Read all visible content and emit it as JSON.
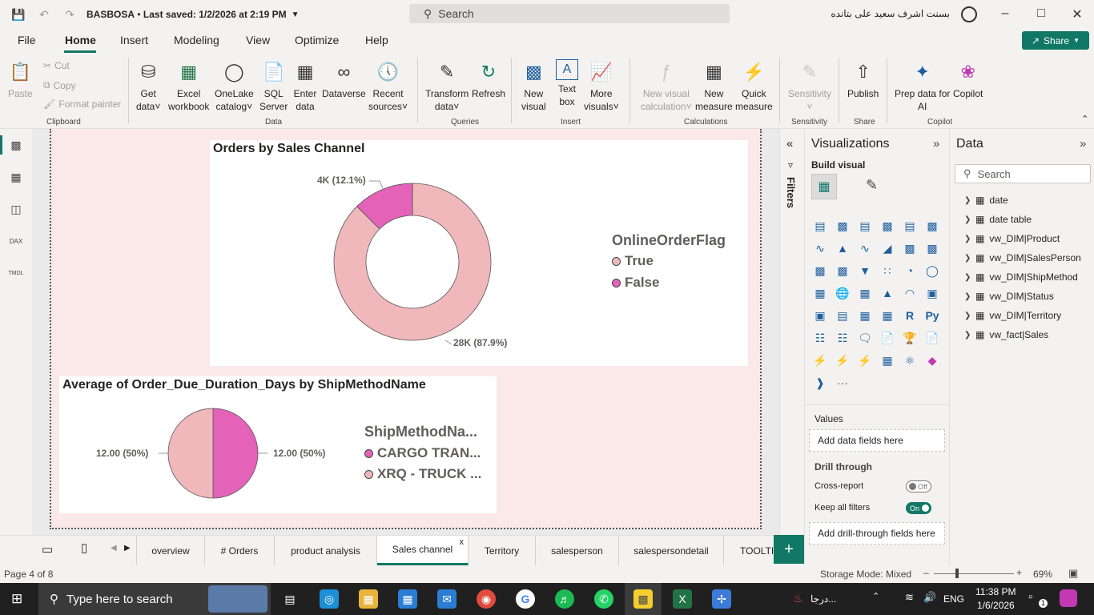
{
  "titlebar": {
    "doc_title": "BASBOSA",
    "saved_status": "Last saved: 1/2/2026 at 2:19 PM",
    "search_placeholder": "Search",
    "user_name": "بسنت اشرف سعيد على بتانده"
  },
  "menu": {
    "items": [
      "File",
      "Home",
      "Insert",
      "Modeling",
      "View",
      "Optimize",
      "Help"
    ],
    "share_label": "Share"
  },
  "ribbon": {
    "paste": "Paste",
    "cut": "Cut",
    "copy": "Copy",
    "format_painter": "Format painter",
    "clipboard_group": "Clipboard",
    "get_data": [
      "Get",
      "data"
    ],
    "excel": [
      "Excel",
      "workbook"
    ],
    "onelake": [
      "OneLake",
      "catalog"
    ],
    "sql": [
      "SQL",
      "Server"
    ],
    "enter_data": [
      "Enter",
      "data"
    ],
    "dataverse": "Dataverse",
    "recent_sources": [
      "Recent",
      "sources"
    ],
    "data_group": "Data",
    "transform": [
      "Transform",
      "data"
    ],
    "refresh": "Refresh",
    "queries_group": "Queries",
    "new_visual": [
      "New",
      "visual"
    ],
    "text_box": [
      "Text",
      "box"
    ],
    "more_visuals": [
      "More",
      "visuals"
    ],
    "insert_group": "Insert",
    "new_visual_calc": [
      "New visual",
      "calculation"
    ],
    "new_measure": [
      "New",
      "measure"
    ],
    "quick_measure": [
      "Quick",
      "measure"
    ],
    "calculations_group": "Calculations",
    "sensitivity": "Sensitivity",
    "sensitivity_group": "Sensitivity",
    "publish": "Publish",
    "share_group": "Share",
    "prep_data": [
      "Prep data for",
      "AI"
    ],
    "copilot": "Copilot",
    "copilot_group": "Copilot"
  },
  "visual1": {
    "title": "Orders by Sales Channel",
    "legend_title": "OnlineOrderFlag",
    "legend_items": [
      "True",
      "False"
    ],
    "label_true": "28K (87.9%)",
    "label_false": "4K (12.1%)"
  },
  "visual2": {
    "title": "Average of Order_Due_Duration_Days by ShipMethodName",
    "legend_title": "ShipMethodNa...",
    "legend_items": [
      "CARGO TRAN...",
      "XRQ - TRUCK ..."
    ],
    "label_left": "12.00 (50%)",
    "label_right": "12.00 (50%)"
  },
  "chart_data": [
    {
      "type": "pie",
      "title": "Orders by Sales Channel",
      "legend_title": "OnlineOrderFlag",
      "categories": [
        "True",
        "False"
      ],
      "values": [
        28000,
        4000
      ],
      "percents": [
        87.9,
        12.1
      ],
      "donut": true,
      "colors": [
        "#f0b8bb",
        "#e462b8"
      ],
      "legend_position": "right"
    },
    {
      "type": "pie",
      "title": "Average of Order_Due_Duration_Days by ShipMethodName",
      "legend_title": "ShipMethodNa...",
      "categories": [
        "CARGO TRAN...",
        "XRQ - TRUCK ..."
      ],
      "values": [
        12.0,
        12.0
      ],
      "percents": [
        50,
        50
      ],
      "donut": false,
      "colors": [
        "#e462b8",
        "#f0b8bb"
      ],
      "legend_position": "right"
    }
  ],
  "filters": {
    "label": "Filters"
  },
  "viz_pane": {
    "title": "Visualizations",
    "build_visual": "Build visual",
    "values_label": "Values",
    "values_placeholder": "Add data fields here",
    "drill_through": "Drill through",
    "cross_report": "Cross-report",
    "cross_report_state": "Off",
    "keep_filters": "Keep all filters",
    "keep_filters_state": "On",
    "drill_placeholder": "Add drill-through fields here",
    "more": "···"
  },
  "data_pane": {
    "title": "Data",
    "search_placeholder": "Search",
    "tables": [
      "date",
      "date table",
      "vw_DIM|Product",
      "vw_DIM|SalesPerson",
      "vw_DIM|ShipMethod",
      "vw_DIM|Status",
      "vw_DIM|Territory",
      "vw_fact|Sales"
    ]
  },
  "tabs": {
    "items": [
      "overview",
      "# Orders",
      "product analysis",
      "Sales channel",
      "Territory",
      "salesperson",
      "salespersondetail",
      "TOOLTI"
    ],
    "active": "Sales channel",
    "close": "x",
    "add": "+"
  },
  "status": {
    "page": "Page 4 of 8",
    "storage": "Storage Mode: Mixed",
    "zoom": "69%",
    "zoom_level": 0.69
  },
  "taskbar": {
    "search_placeholder": "Type here to search",
    "weather": "درجا...",
    "lang": "ENG",
    "time": "11:38 PM",
    "date": "1/6/2026",
    "notif": "1"
  }
}
